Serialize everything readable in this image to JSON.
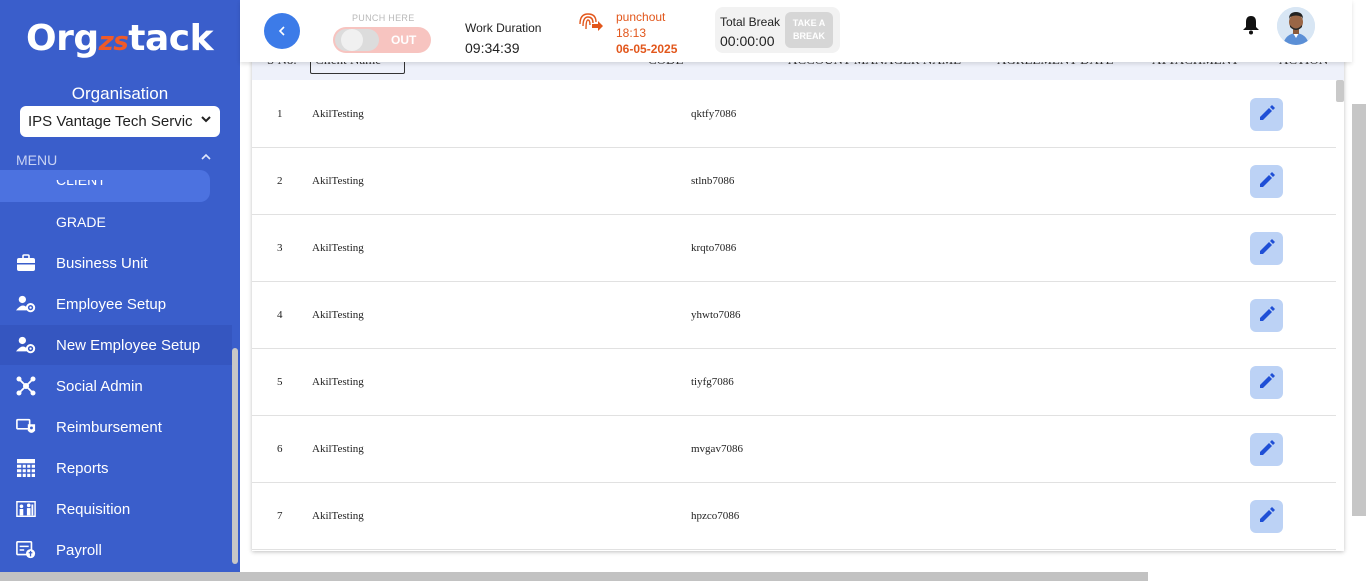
{
  "sidebar": {
    "logo_left": "Org",
    "logo_mid": "zs",
    "logo_right": "tack",
    "org_label": "Organisation",
    "org_selected": "IPS Vantage Tech Services",
    "menu_label": "MENU",
    "client_label": "CLIENT",
    "grade_label": "GRADE",
    "items": [
      {
        "label": "Business Unit",
        "icon": "briefcase-icon"
      },
      {
        "label": "Employee Setup",
        "icon": "users-gear-icon"
      },
      {
        "label": "New Employee Setup",
        "icon": "users-gear-icon"
      },
      {
        "label": "Social Admin",
        "icon": "share-icon"
      },
      {
        "label": "Reimbursement",
        "icon": "money-shield-icon"
      },
      {
        "label": "Reports",
        "icon": "grid-report-icon"
      },
      {
        "label": "Requisition",
        "icon": "people-chart-icon"
      },
      {
        "label": "Payroll",
        "icon": "payroll-icon"
      }
    ]
  },
  "header": {
    "back_icon": "chevron-left-icon",
    "punch_here": "PUNCH HERE",
    "toggle_state": "OUT",
    "work_duration_label": "Work Duration",
    "work_duration_value": "09:34:39",
    "punchout_label": "punchout",
    "punchout_time": "18:13",
    "punchout_date": "06-05-2025",
    "total_break_label": "Total Break",
    "total_break_value": "00:00:00",
    "take_break_line1": "TAKE A",
    "take_break_line2": "BREAK"
  },
  "table": {
    "headers": [
      "S No.",
      "Client Name",
      "CODE",
      "ACCOUNT MANAGER NAME",
      "AGREEMENT DATE",
      "ATTACHMENT",
      "ACTION"
    ],
    "rows": [
      {
        "sno": "1",
        "name": "AkilTesting",
        "code": "qktfy7086"
      },
      {
        "sno": "2",
        "name": "AkilTesting",
        "code": "stlnb7086"
      },
      {
        "sno": "3",
        "name": "AkilTesting",
        "code": "krqto7086"
      },
      {
        "sno": "4",
        "name": "AkilTesting",
        "code": "yhwto7086"
      },
      {
        "sno": "5",
        "name": "AkilTesting",
        "code": "tiyfg7086"
      },
      {
        "sno": "6",
        "name": "AkilTesting",
        "code": "mvgav7086"
      },
      {
        "sno": "7",
        "name": "AkilTesting",
        "code": "hpzco7086"
      }
    ]
  },
  "colors": {
    "sidebar": "#3a5ecb",
    "accent_orange": "#e2571c",
    "edit_button_bg": "#bcd2f5",
    "edit_icon": "#1f4fd6"
  }
}
